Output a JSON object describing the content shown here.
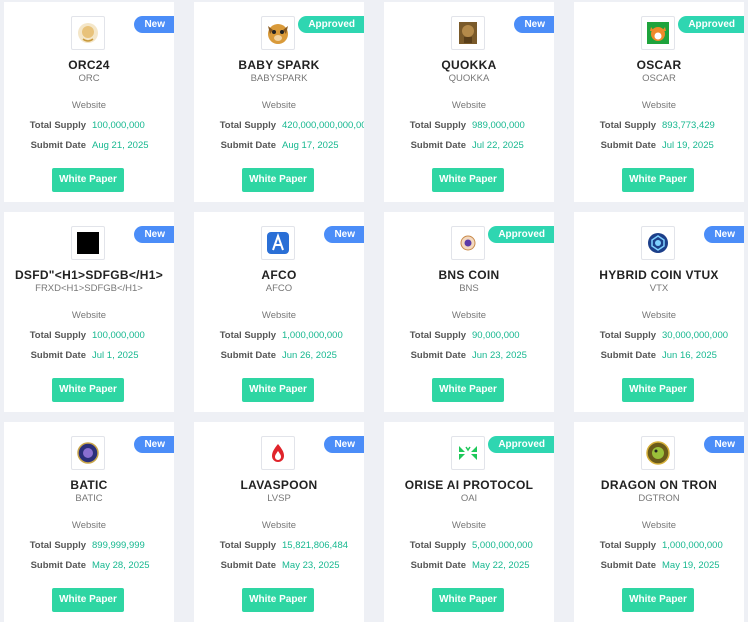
{
  "labels": {
    "website": "Website",
    "total_supply": "Total Supply",
    "submit_date": "Submit Date",
    "white_paper": "White Paper"
  },
  "badge_colors": {
    "New": "#4b8df8",
    "Approved": "#2ed6b1"
  },
  "accent_color": "#2ed6a3",
  "tokens": [
    {
      "name": "ORC24",
      "symbol": "ORC",
      "badge": "New",
      "supply": "100,000,000",
      "date": "Aug 21, 2025",
      "icon": "orc24-logo-icon"
    },
    {
      "name": "BABY SPARK",
      "symbol": "BABYSPARK",
      "badge": "Approved",
      "supply": "420,000,000,000,00",
      "date": "Aug 17, 2025",
      "icon": "dog-logo-icon"
    },
    {
      "name": "QUOKKA",
      "symbol": "QUOKKA",
      "badge": "New",
      "supply": "989,000,000",
      "date": "Jul 22, 2025",
      "icon": "quokka-logo-icon"
    },
    {
      "name": "OSCAR",
      "symbol": "OSCAR",
      "badge": "Approved",
      "supply": "893,773,429",
      "date": "Jul 19, 2025",
      "icon": "shiba-logo-icon"
    },
    {
      "name": "DSFD\"<H1>SDFGB</H1>",
      "symbol": "FRXD<H1>SDFGB</H1>",
      "badge": "New",
      "supply": "100,000,000",
      "date": "Jul 1, 2025",
      "icon": "black-square-logo-icon"
    },
    {
      "name": "AFCO",
      "symbol": "AFCO",
      "badge": "New",
      "supply": "1,000,000,000",
      "date": "Jun 26, 2025",
      "icon": "afco-logo-icon"
    },
    {
      "name": "BNS COIN",
      "symbol": "BNS",
      "badge": "Approved",
      "supply": "90,000,000",
      "date": "Jun 23, 2025",
      "icon": "bns-coin-logo-icon"
    },
    {
      "name": "HYBRID COIN VTUX",
      "symbol": "VTX",
      "badge": "New",
      "supply": "30,000,000,000",
      "date": "Jun 16, 2025",
      "icon": "hybrid-coin-logo-icon"
    },
    {
      "name": "BATIC",
      "symbol": "BATIC",
      "badge": "New",
      "supply": "899,999,999",
      "date": "May 28, 2025",
      "icon": "batic-logo-icon"
    },
    {
      "name": "LAVASPOON",
      "symbol": "LVSP",
      "badge": "New",
      "supply": "15,821,806,484",
      "date": "May 23, 2025",
      "icon": "lavaspoon-logo-icon"
    },
    {
      "name": "ORISE AI PROTOCOL",
      "symbol": "OAI",
      "badge": "Approved",
      "supply": "5,000,000,000",
      "date": "May 22, 2025",
      "icon": "orise-logo-icon"
    },
    {
      "name": "DRAGON ON TRON",
      "symbol": "DGTRON",
      "badge": "New",
      "supply": "1,000,000,000",
      "date": "May 19, 2025",
      "icon": "dragon-logo-icon"
    }
  ]
}
